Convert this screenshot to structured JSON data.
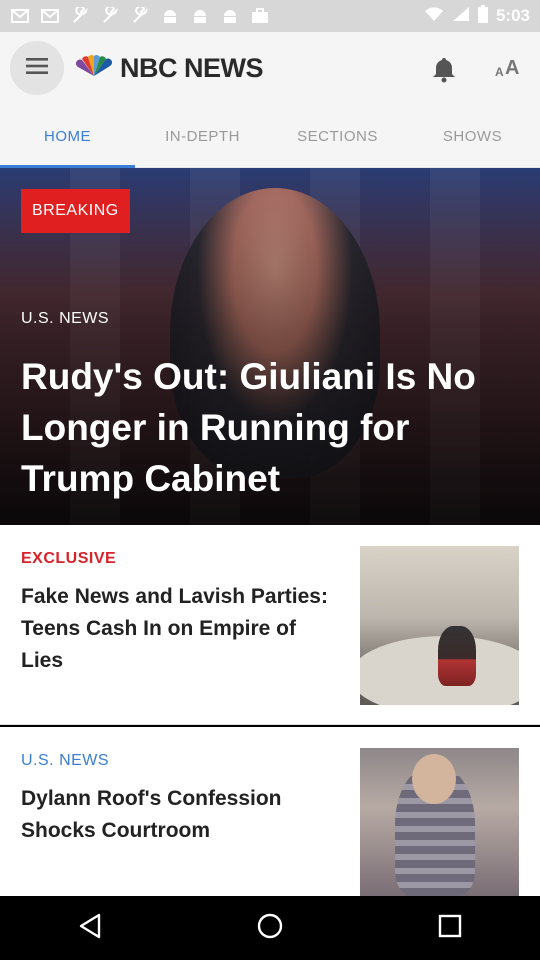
{
  "status_bar": {
    "time": "5:03",
    "left_icons": [
      "mail-icon",
      "mail-icon",
      "tool-icon",
      "tool-icon",
      "tool-icon",
      "android-icon",
      "android-icon",
      "android-icon",
      "briefcase-icon"
    ],
    "right_icons": [
      "wifi-icon",
      "signal-icon",
      "battery-icon"
    ]
  },
  "app_bar": {
    "logo_text": "NBC NEWS",
    "menu_icon": "menu-icon",
    "bell_icon": "bell-icon",
    "text_size_label_small": "A",
    "text_size_label_big": "A"
  },
  "tabs": [
    {
      "label": "HOME",
      "active": true
    },
    {
      "label": "IN-DEPTH",
      "active": false
    },
    {
      "label": "SECTIONS",
      "active": false
    },
    {
      "label": "SHOWS",
      "active": false
    }
  ],
  "hero": {
    "badge": "BREAKING",
    "category": "U.S. NEWS",
    "title": "Rudy's Out: Giuliani Is No Longer in Running for Trump Cabinet"
  },
  "stories": [
    {
      "category": "EXCLUSIVE",
      "title": "Fake News and Lavish Parties: Teens Cash In on Empire of Lies"
    },
    {
      "category": "U.S. NEWS",
      "title": "Dylann Roof's Confession Shocks Courtroom"
    }
  ],
  "colors": {
    "accent_blue": "#3b7ed8",
    "breaking_red": "#e02020",
    "exclusive_red": "#d8232a"
  },
  "nav_bar": {
    "icons": [
      "back-icon",
      "home-icon",
      "recents-icon"
    ]
  }
}
